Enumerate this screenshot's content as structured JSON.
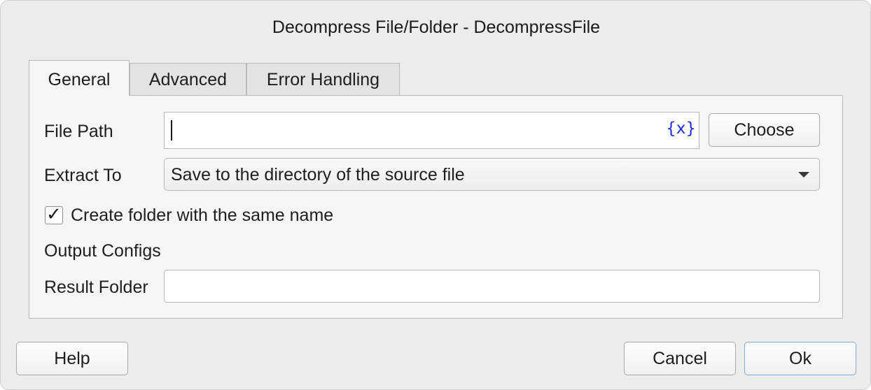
{
  "window": {
    "title": "Decompress File/Folder - DecompressFile"
  },
  "tabs": [
    {
      "label": "General",
      "active": true
    },
    {
      "label": "Advanced",
      "active": false
    },
    {
      "label": "Error Handling",
      "active": false
    }
  ],
  "general": {
    "file_path": {
      "label": "File Path",
      "value": "",
      "variable_icon": "{x}",
      "choose_label": "Choose"
    },
    "extract_to": {
      "label": "Extract To",
      "selected": "Save to the directory of the source file"
    },
    "create_folder": {
      "label": "Create folder with the same name",
      "checked": true,
      "check_glyph": "✓"
    },
    "output_configs": {
      "heading": "Output Configs",
      "result_folder": {
        "label": "Result Folder",
        "value": ""
      }
    }
  },
  "footer": {
    "help_label": "Help",
    "cancel_label": "Cancel",
    "ok_label": "Ok"
  },
  "colors": {
    "dialog_bg": "#ececec",
    "panel_bg": "#f5f5f5",
    "variable_icon": "#1a2fd8",
    "default_button_border": "#7fa6e0"
  },
  "icons": {
    "variable_insert": "variable-icon",
    "dropdown": "chevron-down-icon",
    "checkbox": "checkmark-icon"
  }
}
